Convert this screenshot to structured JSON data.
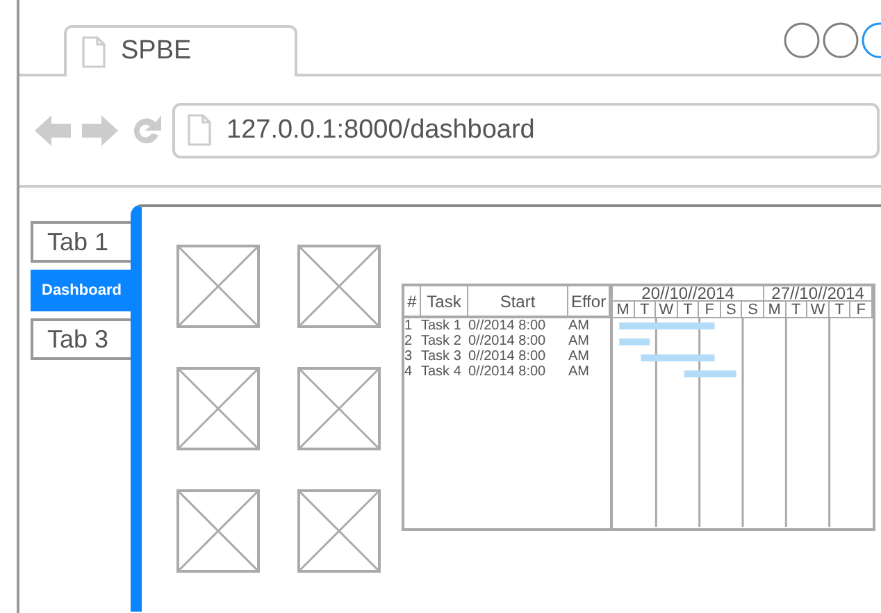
{
  "browser": {
    "tab_title": "SPBE",
    "address": "127.0.0.1:8000/dashboard",
    "window_buttons": [
      {
        "color": "#808080"
      },
      {
        "color": "#808080"
      },
      {
        "color": "#2196f3"
      }
    ]
  },
  "sidebar": {
    "tabs": [
      {
        "label": "Tab 1",
        "selected": false
      },
      {
        "label": "Dashboard",
        "selected": true
      },
      {
        "label": "Tab 3",
        "selected": false
      }
    ]
  },
  "image_placeholders": [
    {
      "kind": "image"
    },
    {
      "kind": "image"
    },
    {
      "kind": "image"
    },
    {
      "kind": "image"
    },
    {
      "kind": "image"
    },
    {
      "kind": "image"
    }
  ],
  "gantt": {
    "columns": [
      "#",
      "Task",
      "Start",
      "Effor"
    ],
    "weeks": [
      {
        "label": "20//10//2014",
        "days": [
          "M",
          "T",
          "W",
          "T",
          "F",
          "S",
          "S"
        ]
      },
      {
        "label": "27//10//2014",
        "days": [
          "M",
          "T",
          "W",
          "T",
          "F"
        ]
      }
    ],
    "rows": [
      {
        "num": "1",
        "task": "Task 1",
        "start": "0//2014 8:00",
        "effort": "AM"
      },
      {
        "num": "2",
        "task": "Task 2",
        "start": "0//2014 8:00",
        "effort": "AM"
      },
      {
        "num": "3",
        "task": "Task 3",
        "start": "0//2014 8:00",
        "effort": "AM"
      },
      {
        "num": "4",
        "task": "Task 4",
        "start": "0//2014 8:00",
        "effort": "AM"
      }
    ]
  }
}
